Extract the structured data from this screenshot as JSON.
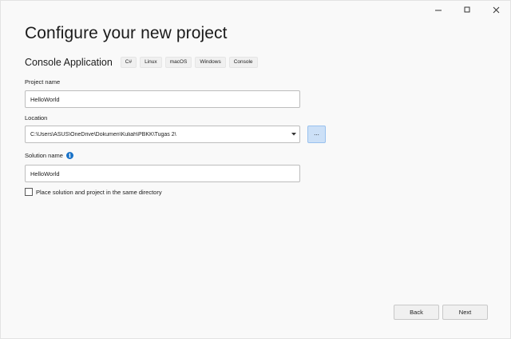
{
  "window": {
    "controls": {
      "minimize_icon": "minimize-icon",
      "maximize_icon": "maximize-icon",
      "close_icon": "close-icon"
    }
  },
  "page": {
    "title": "Configure your new project",
    "template_name": "Console Application",
    "tags": [
      "C#",
      "Linux",
      "macOS",
      "Windows",
      "Console"
    ]
  },
  "form": {
    "project_name_label": "Project name",
    "project_name_value": "HelloWorld",
    "location_label": "Location",
    "location_value": "C:\\Users\\ASUS\\OneDrive\\Dokumen\\Kuliah\\PBKK\\Tugas 2\\",
    "browse_label": "...",
    "solution_name_label": "Solution name",
    "solution_info_icon": "info-icon",
    "solution_name_value": "HelloWorld",
    "same_directory_label": "Place solution and project in the same directory",
    "same_directory_checked": false
  },
  "footer": {
    "back_label": "Back",
    "next_label": "Next"
  },
  "colors": {
    "background": "#f9f9f9",
    "accent": "#1a73c8",
    "browse_bg": "#cce0f7"
  }
}
